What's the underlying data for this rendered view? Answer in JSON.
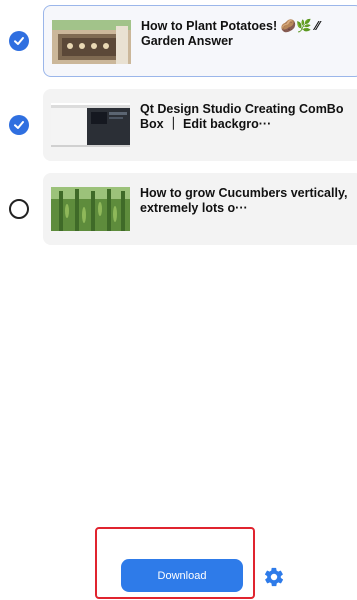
{
  "items": [
    {
      "title": "How to Plant Potatoes! 🥔🌿 ⁄⁄ Garden Answer",
      "selected": true
    },
    {
      "title": "Qt Design Studio Creating ComBo Box ｜ Edit backgro···",
      "selected": true
    },
    {
      "title": "How to grow Cucumbers vertically, extremely lots o···",
      "selected": false
    }
  ],
  "footer": {
    "download_label": "Download"
  },
  "colors": {
    "accent": "#2e7be9",
    "highlight": "#e0242f"
  },
  "icons": {
    "selected": "checkmark-icon",
    "settings": "gear-icon"
  }
}
